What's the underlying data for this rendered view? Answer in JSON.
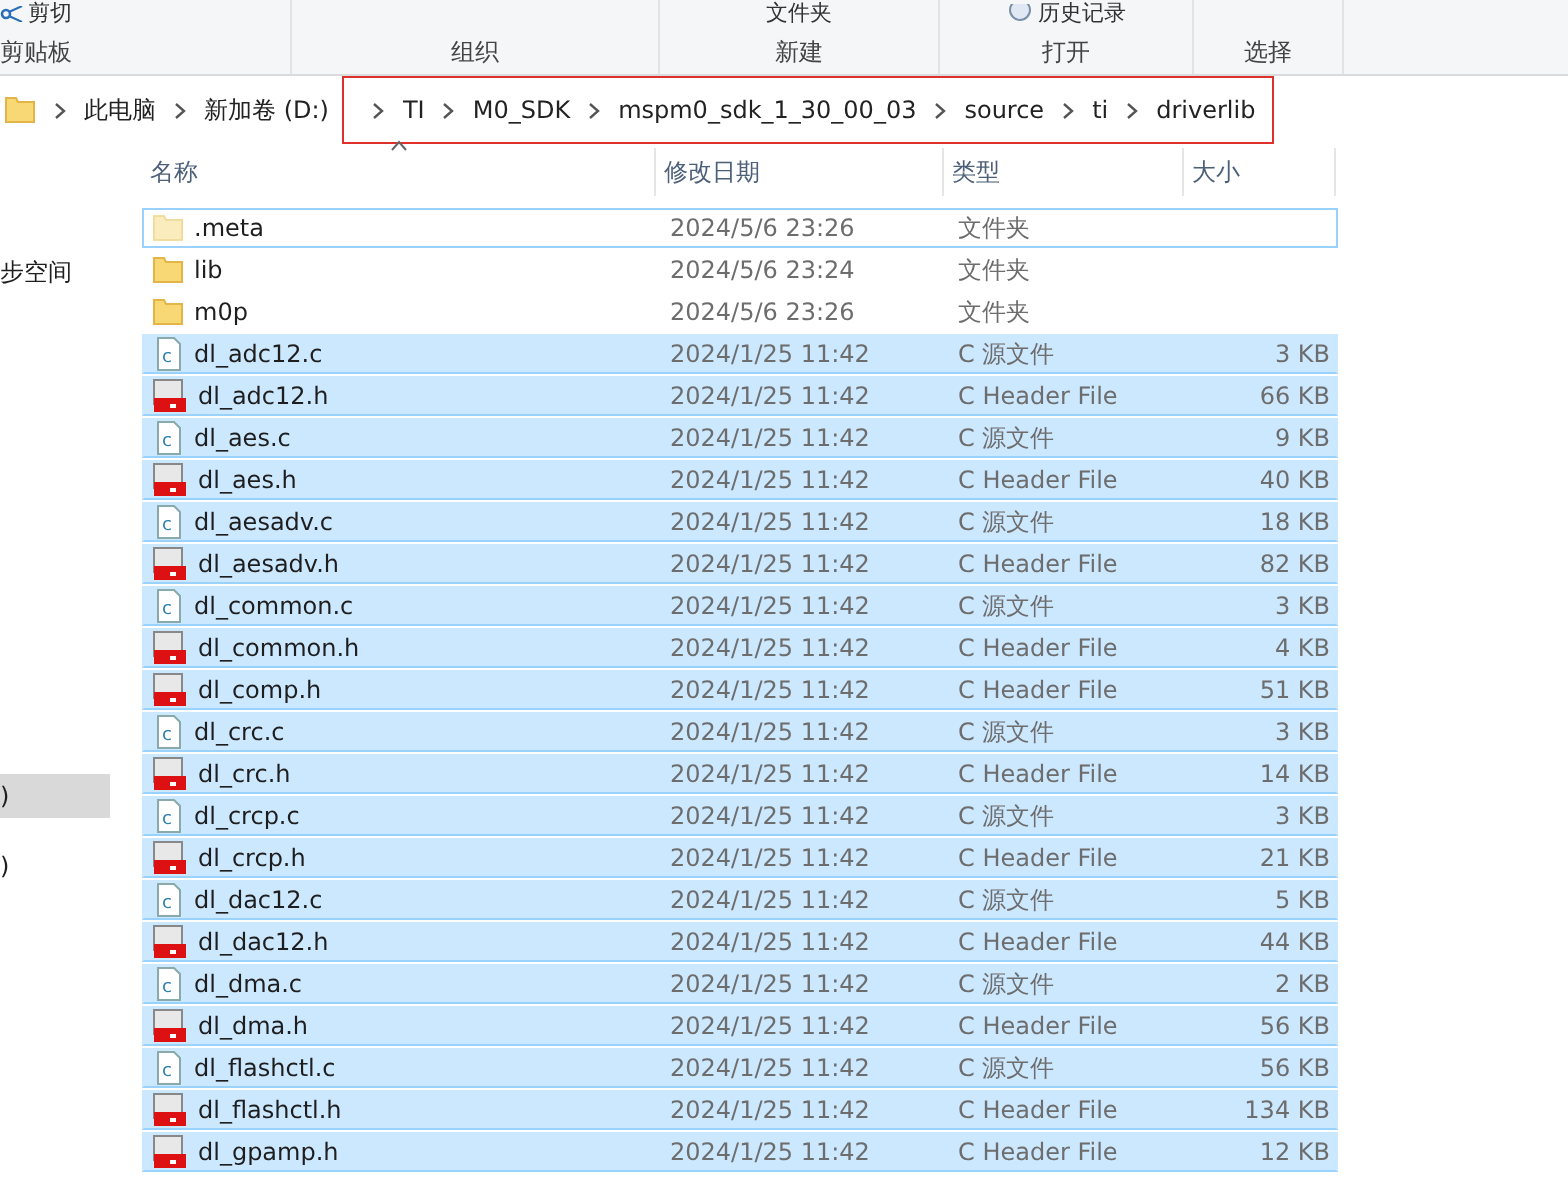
{
  "ribbon": {
    "top_items": [
      {
        "kind": "cut",
        "label": "剪切"
      },
      {
        "kind": "folder",
        "label": "文件夹"
      },
      {
        "kind": "history",
        "label": "历史记录"
      }
    ],
    "groups": [
      "剪贴板",
      "组织",
      "新建",
      "打开",
      "选择"
    ]
  },
  "address_bar": {
    "crumbs_plain": [
      "此电脑",
      "新加卷 (D:)"
    ],
    "crumbs_highlighted": [
      "TI",
      "M0_SDK",
      "mspm0_sdk_1_30_00_03",
      "source",
      "ti",
      "driverlib"
    ]
  },
  "nav_pane": {
    "items": [
      {
        "label": "步空间",
        "selected": false
      },
      {
        "label": ")",
        "selected": true
      },
      {
        "label": ")",
        "selected": false
      }
    ]
  },
  "table": {
    "columns": [
      "名称",
      "修改日期",
      "类型",
      "大小"
    ],
    "rows": [
      {
        "kind": "folder",
        "name": ".meta",
        "date": "2024/5/6 23:26",
        "type": "文件夹",
        "selected": false,
        "focused": true
      },
      {
        "kind": "folder",
        "name": "lib",
        "date": "2024/5/6 23:24",
        "type": "文件夹",
        "selected": false,
        "focused": false
      },
      {
        "kind": "folder",
        "name": "m0p",
        "date": "2024/5/6 23:26",
        "type": "文件夹",
        "selected": false,
        "focused": false
      },
      {
        "kind": "c",
        "name": "dl_adc12.c",
        "date": "2024/1/25 11:42",
        "type": "C 源文件",
        "size": "3 KB",
        "selected": true,
        "focused": false
      },
      {
        "kind": "h",
        "name": "dl_adc12.h",
        "date": "2024/1/25 11:42",
        "type": "C Header File",
        "size": "66 KB",
        "selected": true,
        "focused": false
      },
      {
        "kind": "c",
        "name": "dl_aes.c",
        "date": "2024/1/25 11:42",
        "type": "C 源文件",
        "size": "9 KB",
        "selected": true,
        "focused": false
      },
      {
        "kind": "h",
        "name": "dl_aes.h",
        "date": "2024/1/25 11:42",
        "type": "C Header File",
        "size": "40 KB",
        "selected": true,
        "focused": false
      },
      {
        "kind": "c",
        "name": "dl_aesadv.c",
        "date": "2024/1/25 11:42",
        "type": "C 源文件",
        "size": "18 KB",
        "selected": true,
        "focused": false
      },
      {
        "kind": "h",
        "name": "dl_aesadv.h",
        "date": "2024/1/25 11:42",
        "type": "C Header File",
        "size": "82 KB",
        "selected": true,
        "focused": false
      },
      {
        "kind": "c",
        "name": "dl_common.c",
        "date": "2024/1/25 11:42",
        "type": "C 源文件",
        "size": "3 KB",
        "selected": true,
        "focused": false
      },
      {
        "kind": "h",
        "name": "dl_common.h",
        "date": "2024/1/25 11:42",
        "type": "C Header File",
        "size": "4 KB",
        "selected": true,
        "focused": false
      },
      {
        "kind": "h",
        "name": "dl_comp.h",
        "date": "2024/1/25 11:42",
        "type": "C Header File",
        "size": "51 KB",
        "selected": true,
        "focused": false
      },
      {
        "kind": "c",
        "name": "dl_crc.c",
        "date": "2024/1/25 11:42",
        "type": "C 源文件",
        "size": "3 KB",
        "selected": true,
        "focused": false
      },
      {
        "kind": "h",
        "name": "dl_crc.h",
        "date": "2024/1/25 11:42",
        "type": "C Header File",
        "size": "14 KB",
        "selected": true,
        "focused": false
      },
      {
        "kind": "c",
        "name": "dl_crcp.c",
        "date": "2024/1/25 11:42",
        "type": "C 源文件",
        "size": "3 KB",
        "selected": true,
        "focused": false
      },
      {
        "kind": "h",
        "name": "dl_crcp.h",
        "date": "2024/1/25 11:42",
        "type": "C Header File",
        "size": "21 KB",
        "selected": true,
        "focused": false
      },
      {
        "kind": "c",
        "name": "dl_dac12.c",
        "date": "2024/1/25 11:42",
        "type": "C 源文件",
        "size": "5 KB",
        "selected": true,
        "focused": false
      },
      {
        "kind": "h",
        "name": "dl_dac12.h",
        "date": "2024/1/25 11:42",
        "type": "C Header File",
        "size": "44 KB",
        "selected": true,
        "focused": false
      },
      {
        "kind": "c",
        "name": "dl_dma.c",
        "date": "2024/1/25 11:42",
        "type": "C 源文件",
        "size": "2 KB",
        "selected": true,
        "focused": false
      },
      {
        "kind": "h",
        "name": "dl_dma.h",
        "date": "2024/1/25 11:42",
        "type": "C Header File",
        "size": "56 KB",
        "selected": true,
        "focused": false
      },
      {
        "kind": "c",
        "name": "dl_flashctl.c",
        "date": "2024/1/25 11:42",
        "type": "C 源文件",
        "size": "56 KB",
        "selected": true,
        "focused": false
      },
      {
        "kind": "h",
        "name": "dl_flashctl.h",
        "date": "2024/1/25 11:42",
        "type": "C Header File",
        "size": "134 KB",
        "selected": true,
        "focused": false
      },
      {
        "kind": "h",
        "name": "dl_gpamp.h",
        "date": "2024/1/25 11:42",
        "type": "C Header File",
        "size": "12 KB",
        "selected": true,
        "focused": false
      }
    ]
  }
}
